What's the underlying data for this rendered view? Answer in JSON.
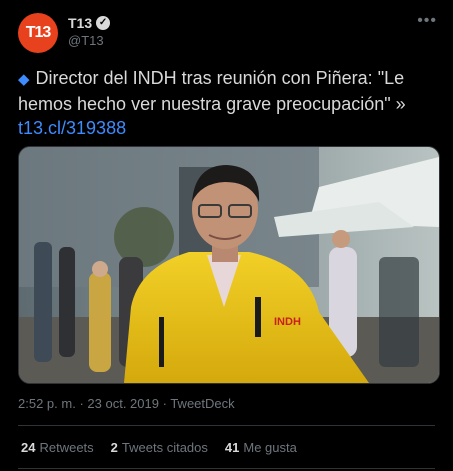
{
  "account": {
    "avatar_text": "T13",
    "name": "T13",
    "handle": "@T13",
    "verified_glyph": "✓"
  },
  "tweet": {
    "diamond_glyph": "◆",
    "text": "Director del INDH tras reunión con Piñera: \"Le hemos hecho ver nuestra grave preocupación\" »",
    "link": "t13.cl/319388"
  },
  "media": {
    "jacket_text": "INDH"
  },
  "meta": {
    "time": "2:52 p. m.",
    "separator": "·",
    "date": "23 oct. 2019",
    "source": "TweetDeck"
  },
  "stats": {
    "retweets_count": "24",
    "retweets_label": "Retweets",
    "quotes_count": "2",
    "quotes_label": "Tweets citados",
    "likes_count": "41",
    "likes_label": "Me gusta"
  },
  "colors": {
    "background": "#000000",
    "accent_link": "#3d8bfd",
    "avatar_brand": "#e8411d",
    "muted_text": "#6e767d",
    "primary_text": "#d9d9d9"
  }
}
